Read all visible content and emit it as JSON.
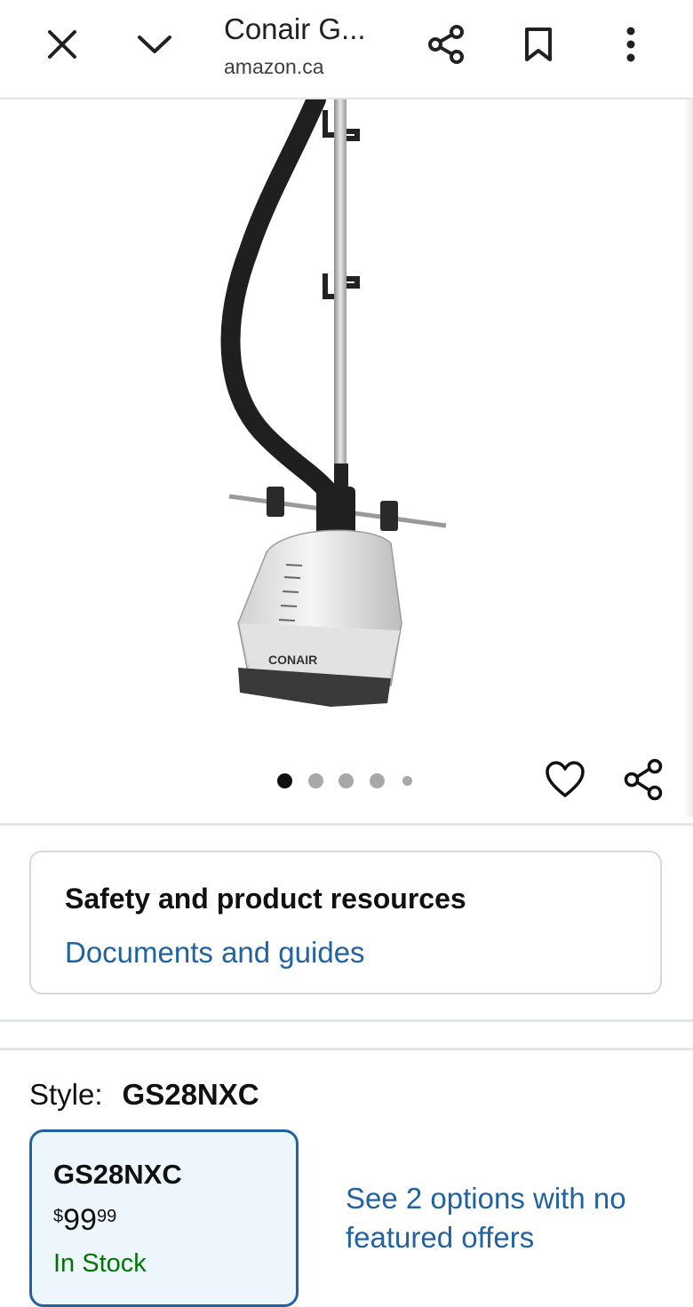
{
  "browser_bar": {
    "title": "Conair G...",
    "url": "amazon.ca",
    "icons": [
      "close-icon",
      "chevron-down-icon",
      "share-icon",
      "bookmark-icon",
      "more-vert-icon"
    ]
  },
  "product_image": {
    "brand_mark": "CONAIR",
    "carousel_total": 5,
    "carousel_active": 1
  },
  "actions": {
    "icons": [
      "heart-icon",
      "share-icon"
    ]
  },
  "safety": {
    "title": "Safety and product resources",
    "link": "Documents and guides"
  },
  "style": {
    "label": "Style:",
    "value": "GS28NXC",
    "selected_option": {
      "name": "GS28NXC",
      "price_symbol": "$",
      "price_whole": "99",
      "price_fraction": "99",
      "stock": "In Stock"
    },
    "more_options": "See 2 options with no featured offers"
  },
  "colors": {
    "link": "#2162a1",
    "in_stock": "#007600",
    "selected_border": "#2162a1",
    "selected_bg": "#edf6fd"
  }
}
